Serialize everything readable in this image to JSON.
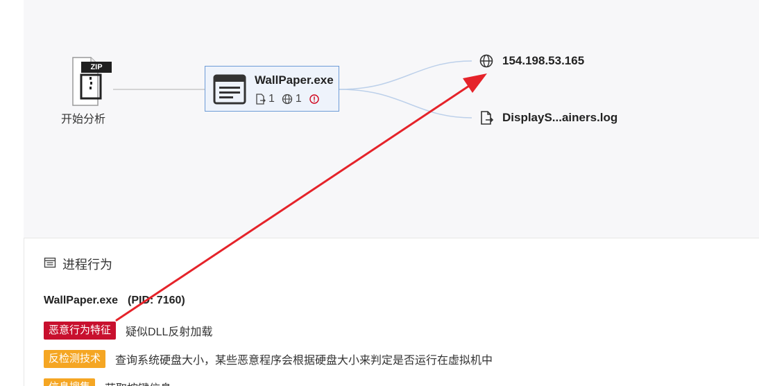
{
  "graph": {
    "start_node": {
      "icon": "zip-file-icon",
      "badge": "ZIP",
      "label": "开始分析"
    },
    "process_node": {
      "icon": "window-app-icon",
      "name": "WallPaper.exe",
      "file_count": "1",
      "network_count": "1",
      "alert_icon": "alert-circle-icon"
    },
    "leaves": [
      {
        "icon": "globe-icon",
        "label": "154.198.53.165"
      },
      {
        "icon": "file-export-icon",
        "label": "DisplayS...ainers.log"
      }
    ]
  },
  "behavior_panel": {
    "title_icon": "list-icon",
    "title": "进程行为",
    "process_name": "WallPaper.exe",
    "pid_text": "(PID: 7160)",
    "items": [
      {
        "tag": "恶意行为特征",
        "tag_color": "#c8102e",
        "description": "疑似DLL反射加载"
      },
      {
        "tag": "反检测技术",
        "tag_color": "#f5a623",
        "description": "查询系统硬盘大小，某些恶意程序会根据硬盘大小来判定是否运行在虚拟机中"
      },
      {
        "tag": "信息搜集",
        "tag_color": "#f5a623",
        "description": "获取按键信息"
      }
    ]
  },
  "annotation": {
    "arrow_color": "#e5232a"
  }
}
